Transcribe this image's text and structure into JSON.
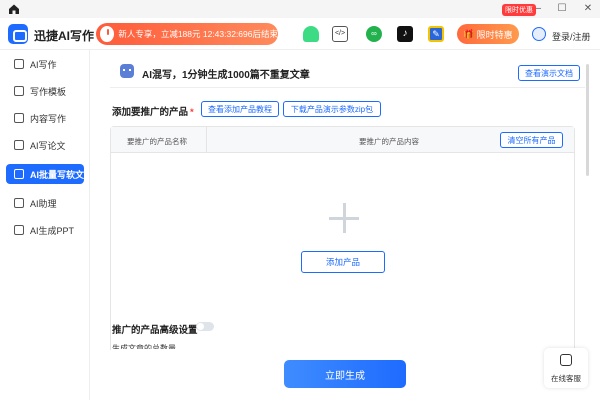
{
  "window": {
    "minimize": "—",
    "maximize": "☐",
    "close": "✕"
  },
  "header": {
    "brand": "迅捷AI写作",
    "promo": "新人专享，立减188元 12:43:32:696后结束",
    "offer_tag": "限时优惠",
    "offer_label": "限时特惠",
    "login": "登录/注册"
  },
  "sidebar": {
    "items": [
      {
        "label": "AI写作"
      },
      {
        "label": "写作模板"
      },
      {
        "label": "内容写作"
      },
      {
        "label": "AI写论文"
      },
      {
        "label": "AI批量写软文"
      },
      {
        "label": "AI助理"
      },
      {
        "label": "AI生成PPT"
      }
    ]
  },
  "main": {
    "ai_title": "AI混写，1分钟生成1000篇不重复文章",
    "demo_doc": "查看演示文档",
    "section_label": "添加要推广的产品",
    "required": "*",
    "tutorial": "查看添加产品教程",
    "download": "下载产品演示参数zip包",
    "col_name": "要推广的产品名称",
    "col_content": "要推广的产品内容",
    "clear_all": "清空所有产品",
    "add_product": "添加产品",
    "advanced": "推广的产品高级设置",
    "total_label": "生成文章的总数量",
    "generate": "立即生成",
    "customer_service": "在线客服"
  },
  "colors": {
    "accent": "#1e6bff",
    "promo": "#ff5b3a"
  }
}
